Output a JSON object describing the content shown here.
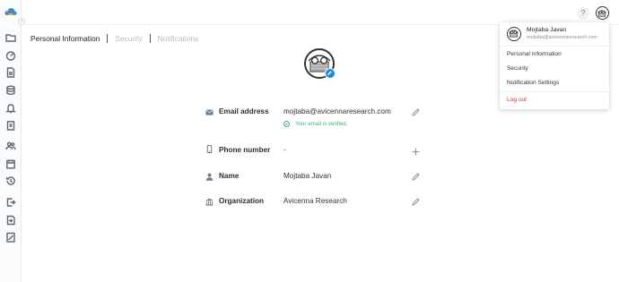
{
  "sidebar": {
    "logo_icon": "cloud-logo-icon",
    "toggle_glyph": "›",
    "items": [
      {
        "icon": "folder-icon"
      },
      {
        "icon": "dashboard-icon"
      },
      {
        "icon": "document-icon"
      },
      {
        "icon": "database-icon"
      },
      {
        "icon": "bell-icon"
      },
      {
        "icon": "clipboard-icon"
      },
      {
        "icon": "users-icon"
      },
      {
        "icon": "calendar-icon"
      },
      {
        "icon": "history-icon"
      },
      {
        "icon": "export-icon"
      },
      {
        "icon": "login-icon"
      },
      {
        "icon": "report-icon"
      }
    ]
  },
  "header": {
    "help_label": "?"
  },
  "tabs": [
    {
      "label": "Personal Information",
      "active": true
    },
    {
      "label": "Security",
      "active": false
    },
    {
      "label": "Notifications",
      "active": false
    }
  ],
  "profile": {
    "fields": {
      "email": {
        "label": "Email address",
        "value": "mojtaba@avicennaresearch.com",
        "icon": "mail-icon",
        "action": "edit-icon"
      },
      "phone": {
        "label": "Phone number",
        "value": "-",
        "icon": "phone-icon",
        "action": "plus-icon"
      },
      "name": {
        "label": "Name",
        "value": "Mojtaba Javan",
        "icon": "person-icon",
        "action": "edit-icon"
      },
      "organization": {
        "label": "Organization",
        "value": "Avicenna Research",
        "icon": "bank-icon",
        "action": "edit-icon"
      }
    },
    "email_verified_text": "Your email is verified."
  },
  "dropdown": {
    "user_name": "Mojtaba Javan",
    "user_email": "mojtaba@avicennaresearch.com",
    "items": [
      {
        "label": "Personal Information"
      },
      {
        "label": "Security"
      },
      {
        "label": "Notification Settings"
      }
    ],
    "logout_label": "Log out"
  },
  "colors": {
    "accent": "#1e88e5",
    "verified": "#43b36b",
    "logout": "#c0392b",
    "muted_tab": "#b8bcc2"
  }
}
